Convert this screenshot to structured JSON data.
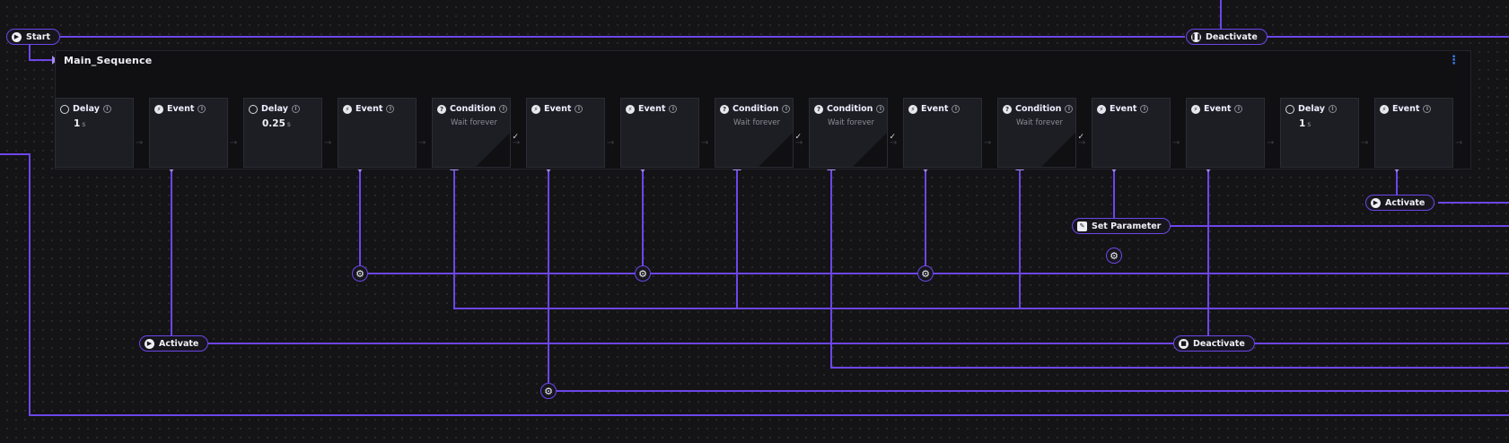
{
  "start_label": "Start",
  "top_deactivate_label": "Deactivate",
  "sequence": {
    "title": "Main_Sequence",
    "menu_icon": "kebab-menu-icon",
    "steps": [
      {
        "type": "Delay",
        "value": "1",
        "unit": "s"
      },
      {
        "type": "Event"
      },
      {
        "type": "Delay",
        "value": "0.25",
        "unit": "s"
      },
      {
        "type": "Event"
      },
      {
        "type": "Condition",
        "sub": "Wait forever",
        "check": "✓"
      },
      {
        "type": "Event"
      },
      {
        "type": "Event"
      },
      {
        "type": "Condition",
        "sub": "Wait forever",
        "check": "✓"
      },
      {
        "type": "Condition",
        "sub": "Wait forever",
        "check": "✓"
      },
      {
        "type": "Event"
      },
      {
        "type": "Condition",
        "sub": "Wait forever",
        "check": "✓"
      },
      {
        "type": "Event"
      },
      {
        "type": "Event"
      },
      {
        "type": "Delay",
        "value": "1",
        "unit": "s"
      },
      {
        "type": "Event"
      }
    ]
  },
  "nodes": {
    "activate_right": "Activate",
    "set_parameter": "Set Parameter",
    "activate_left": "Activate",
    "deactivate_bottom": "Deactivate"
  },
  "colors": {
    "wire": "#6d46ea",
    "background": "#141416",
    "step": "#1d1e24"
  }
}
